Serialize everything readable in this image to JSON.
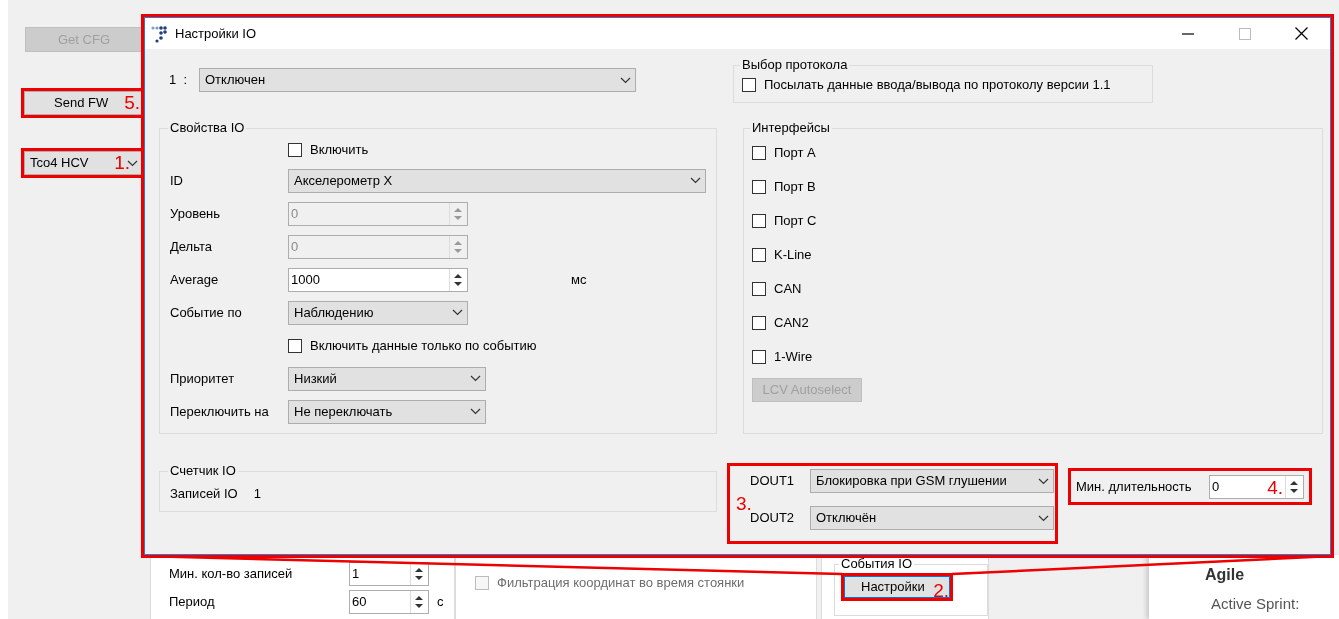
{
  "app": {
    "buttons": [
      {
        "label": "Get CFG",
        "disabled": true
      },
      {
        "label": "Send FW",
        "disabled": false,
        "annotation": "5."
      }
    ],
    "device": {
      "value": "Tco4 HCV",
      "annotation": "1."
    },
    "records": [
      {
        "label": "Мин. кол-во записей",
        "value": "1"
      },
      {
        "label": "Период",
        "value": "60",
        "unit": "с"
      }
    ],
    "filter": {
      "label": "Фильтрация координат во время стоянки",
      "checked": false,
      "disabled": true
    },
    "io_events": {
      "title": "События IO",
      "button": "Настройки",
      "annotation": "2."
    },
    "agile": {
      "title": "Agile",
      "sprint": "Active Sprint:"
    }
  },
  "dialog": {
    "title": "Настройки IO",
    "channel": {
      "label": "1  :",
      "value": "Отключен"
    },
    "protocol": {
      "title": "Выбор протокола",
      "label": "Посылать данные ввода/вывода по протоколу версии 1.1",
      "checked": false
    },
    "properties": {
      "title": "Свойства IO",
      "rows": [
        {
          "kind": "checkbox",
          "label": "Включить",
          "checked": false
        },
        {
          "kind": "combo",
          "label": "ID",
          "value": "Акселерометр X"
        },
        {
          "kind": "spin",
          "label": "Уровень",
          "value": "0",
          "disabled": true
        },
        {
          "kind": "spin",
          "label": "Дельта",
          "value": "0",
          "disabled": true
        },
        {
          "kind": "spin",
          "label": "Average",
          "value": "1000",
          "disabled": false,
          "unit": "мс"
        },
        {
          "kind": "combo",
          "label": "Событие по",
          "value": "Наблюдению"
        },
        {
          "kind": "checkbox",
          "label": "Включить данные только по событию",
          "checked": false
        },
        {
          "kind": "combo",
          "label": "Приоритет",
          "value": "Низкий"
        },
        {
          "kind": "combo",
          "label": "Переключить на",
          "value": "Не переключать"
        }
      ]
    },
    "interfaces": {
      "title": "Интерфейсы",
      "items": [
        {
          "label": "Порт A",
          "checked": false
        },
        {
          "label": "Порт B",
          "checked": false
        },
        {
          "label": "Порт C",
          "checked": false
        },
        {
          "label": "K-Line",
          "checked": false
        },
        {
          "label": "CAN",
          "checked": false
        },
        {
          "label": "CAN2",
          "checked": false
        },
        {
          "label": "1-Wire",
          "checked": false
        }
      ],
      "button": {
        "label": "LCV Autoselect",
        "disabled": true
      }
    },
    "counter": {
      "title": "Счетчик IO",
      "label": "Записей IO",
      "value": "1"
    },
    "outputs": {
      "annotation": "3.",
      "items": [
        {
          "label": "DOUT1",
          "value": "Блокировка при GSM глушении"
        },
        {
          "label": "DOUT2",
          "value": "Отключён"
        }
      ]
    },
    "min_duration": {
      "label": "Мин. длительность",
      "value": "0",
      "annotation": "4."
    }
  }
}
